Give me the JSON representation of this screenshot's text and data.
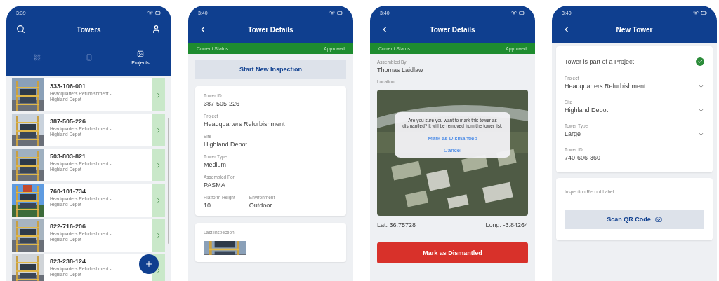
{
  "screens": [
    {
      "kind": "list",
      "time": "3:39",
      "title": "Towers",
      "tabs": [
        {
          "selected": false
        },
        {
          "selected": false
        },
        {
          "label": "Projects",
          "selected": true
        }
      ],
      "towers": [
        {
          "id": "333-106-001",
          "subtitle": "Headquarters Refurbishment - Highland Depot"
        },
        {
          "id": "387-505-226",
          "subtitle": "Headquarters Refurbishment - Highland Depot"
        },
        {
          "id": "503-803-821",
          "subtitle": "Headquarters Refurbishment - Highland Depot"
        },
        {
          "id": "760-101-734",
          "subtitle": "Headquarters Refurbishment - Highland Depot"
        },
        {
          "id": "822-716-206",
          "subtitle": "Headquarters Refurbishment - Highland Depot"
        },
        {
          "id": "823-238-124",
          "subtitle": "Headquarters Refurbishment - Highland Depot"
        }
      ]
    },
    {
      "kind": "details",
      "time": "3:40",
      "title": "Tower Details",
      "status_label": "Current Status",
      "status_value": "Approved",
      "action": "Start New Inspection",
      "fields": [
        {
          "label": "Tower ID",
          "value": "387-505-226"
        },
        {
          "label": "Project",
          "value": "Headquarters Refurbishment"
        },
        {
          "label": "Site",
          "value": "Highland Depot"
        },
        {
          "label": "Tower Type",
          "value": "Medium"
        },
        {
          "label": "Assembled For",
          "value": "PASMA"
        }
      ],
      "pair": [
        {
          "label": "Platform Height",
          "value": "10"
        },
        {
          "label": "Environment",
          "value": "Outdoor"
        }
      ],
      "last_inspection": "Last Inspection"
    },
    {
      "kind": "location",
      "time": "3:40",
      "title": "Tower Details",
      "status_label": "Current Status",
      "status_value": "Approved",
      "assembled_label": "Assembled By",
      "assembled_value": "Thomas Laidlaw",
      "location_label": "Location",
      "dialog": {
        "message": "Are you sure you want to mark this tower as dismantled? It will be removed from the tower list.",
        "confirm": "Mark as Dismantled",
        "cancel": "Cancel"
      },
      "lat": "Lat: 36.75728",
      "long": "Long: -3.84264",
      "action": "Mark as Dismantled"
    },
    {
      "kind": "form",
      "time": "3:40",
      "title": "New Tower",
      "toggle": {
        "label": "Tower is part of a Project",
        "checked": true
      },
      "selects": [
        {
          "label": "Project",
          "value": "Headquarters Refurbishment"
        },
        {
          "label": "Site",
          "value": "Highland Depot"
        },
        {
          "label": "Tower Type",
          "value": "Large"
        }
      ],
      "id_field": {
        "label": "Tower ID",
        "value": "740-606-360"
      },
      "record_label": "Inspection Record Label",
      "scan": "Scan QR Code"
    }
  ]
}
